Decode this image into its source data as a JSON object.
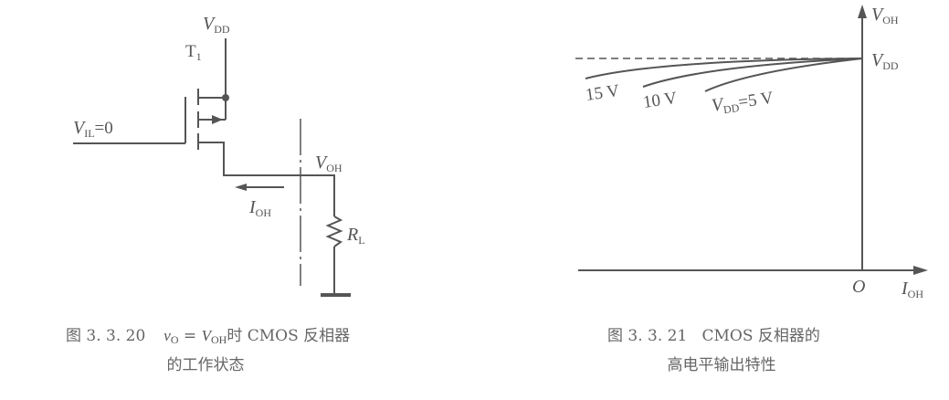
{
  "fig_left": {
    "vdd": {
      "main": "V",
      "sub": "DD"
    },
    "t1": {
      "main": "T",
      "sub": "1"
    },
    "vil": {
      "main": "V",
      "sub": "IL",
      "rest": "=0"
    },
    "voh": {
      "main": "V",
      "sub": "OH"
    },
    "ioh": {
      "main": "I",
      "sub": "OH"
    },
    "rl": {
      "main": "R",
      "sub": "L"
    },
    "caption_line1": {
      "prefix": "图 3. 3. 20",
      "vo": "v",
      "vo_sub": "O",
      "eq": " = ",
      "voh": "V",
      "voh_sub": "OH",
      "rest": "时 CMOS 反相器"
    },
    "caption_line2": "的工作状态"
  },
  "fig_right": {
    "y_axis": {
      "main": "V",
      "sub": "OH"
    },
    "x_axis": {
      "main": "I",
      "sub": "OH"
    },
    "origin": "O",
    "vdd_level": {
      "main": "V",
      "sub": "DD"
    },
    "curves": [
      {
        "label": "15 V"
      },
      {
        "label": "10 V"
      },
      {
        "label_main": "V",
        "label_sub": "DD",
        "label_rest": "=5 V"
      }
    ],
    "caption_line1": "图 3. 3. 21   CMOS 反相器的",
    "caption_line2": "高电平输出特性"
  }
}
